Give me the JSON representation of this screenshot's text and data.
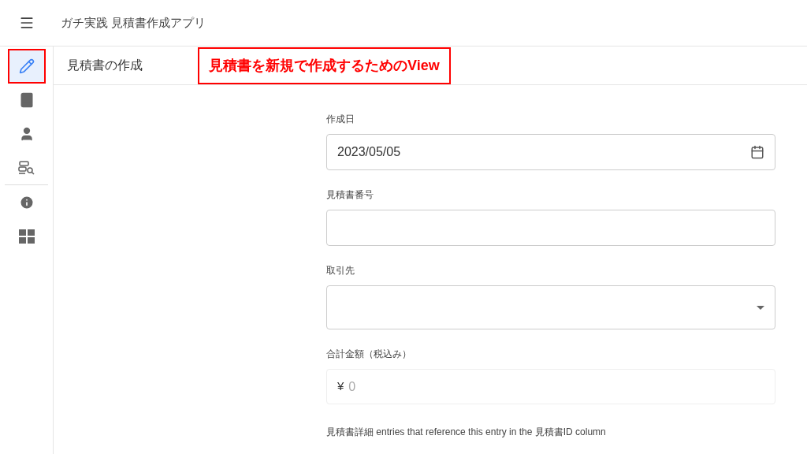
{
  "app_bar": {
    "title": "ガチ実践 見積書作成アプリ"
  },
  "nav": {
    "primary": [
      {
        "kind": "edit",
        "selected": true,
        "highlighted": true
      },
      {
        "kind": "book",
        "selected": false,
        "highlighted": false
      },
      {
        "kind": "person",
        "selected": false,
        "highlighted": false
      },
      {
        "kind": "search-list",
        "selected": false,
        "highlighted": false
      }
    ],
    "secondary": [
      {
        "kind": "info",
        "selected": false,
        "highlighted": false
      },
      {
        "kind": "grid",
        "selected": false,
        "highlighted": false
      }
    ]
  },
  "view": {
    "title": "見積書の作成",
    "callout": "見積書を新規で作成するためのView"
  },
  "form": {
    "fields": [
      {
        "kind": "date",
        "label": "作成日",
        "value": "2023/05/05",
        "disabled": false
      },
      {
        "kind": "text",
        "label": "見積書番号",
        "disabled": false
      },
      {
        "kind": "select",
        "label": "取引先",
        "disabled": false
      },
      {
        "kind": "currency",
        "label": "合計金額（税込み）",
        "prefix": "¥",
        "placeholder": "0",
        "disabled": true
      }
    ],
    "related_note": "見積書詳細 entries that reference this entry in the 見積書ID column"
  }
}
